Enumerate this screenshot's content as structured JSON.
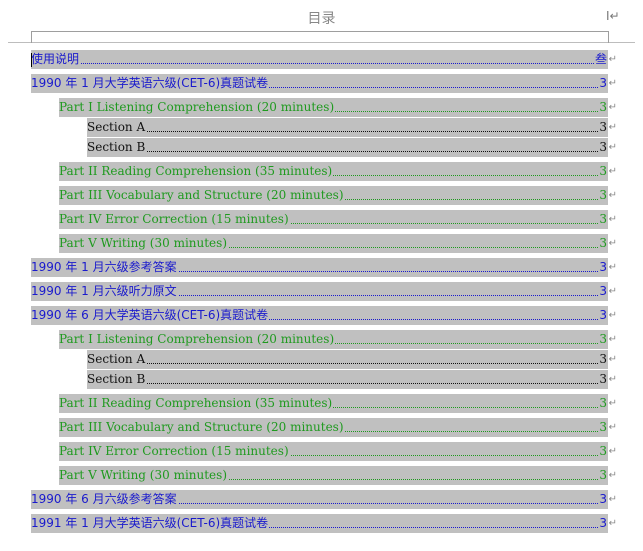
{
  "header": {
    "title": "目录",
    "cursor_mark": "I↵"
  },
  "toc": [
    {
      "level": 1,
      "text": "使用说明",
      "page": "叁"
    },
    {
      "level": 1,
      "text": "1990 年 1 月大学英语六级(CET-6)真题试卷",
      "page": "3"
    },
    {
      "level": 2,
      "text": "Part I Listening Comprehension (20 minutes)",
      "page": "3"
    },
    {
      "level": 3,
      "text": "Section A",
      "page": "3"
    },
    {
      "level": 3,
      "text": "Section B",
      "page": "3"
    },
    {
      "level": 2,
      "text": "Part II Reading Comprehension (35 minutes)",
      "page": "3"
    },
    {
      "level": 2,
      "text": "Part III Vocabulary and Structure (20 minutes)",
      "page": "3"
    },
    {
      "level": 2,
      "text": "Part IV Error Correction (15 minutes)",
      "page": "3"
    },
    {
      "level": 2,
      "text": "Part V Writing (30 minutes)",
      "page": "3"
    },
    {
      "level": 1,
      "text": "1990 年 1 月六级参考答案",
      "page": "3"
    },
    {
      "level": 1,
      "text": "1990 年 1 月六级听力原文",
      "page": "3"
    },
    {
      "level": 1,
      "text": "1990 年 6 月大学英语六级(CET-6)真题试卷",
      "page": "3"
    },
    {
      "level": 2,
      "text": "Part I Listening Comprehension (20 minutes)",
      "page": "3"
    },
    {
      "level": 3,
      "text": "Section A",
      "page": "3"
    },
    {
      "level": 3,
      "text": "Section B",
      "page": "3"
    },
    {
      "level": 2,
      "text": "Part II Reading Comprehension (35 minutes)",
      "page": "3"
    },
    {
      "level": 2,
      "text": "Part III Vocabulary and Structure (20 minutes)",
      "page": "3"
    },
    {
      "level": 2,
      "text": "Part IV Error Correction (15 minutes)",
      "page": "3"
    },
    {
      "level": 2,
      "text": "Part V Writing (30 minutes)",
      "page": "3"
    },
    {
      "level": 1,
      "text": "1990 年 6 月六级参考答案",
      "page": "3"
    },
    {
      "level": 1,
      "text": "1991 年 1 月大学英语六级(CET-6)真题试卷",
      "page": "3"
    }
  ],
  "paragraph_mark": "↵"
}
